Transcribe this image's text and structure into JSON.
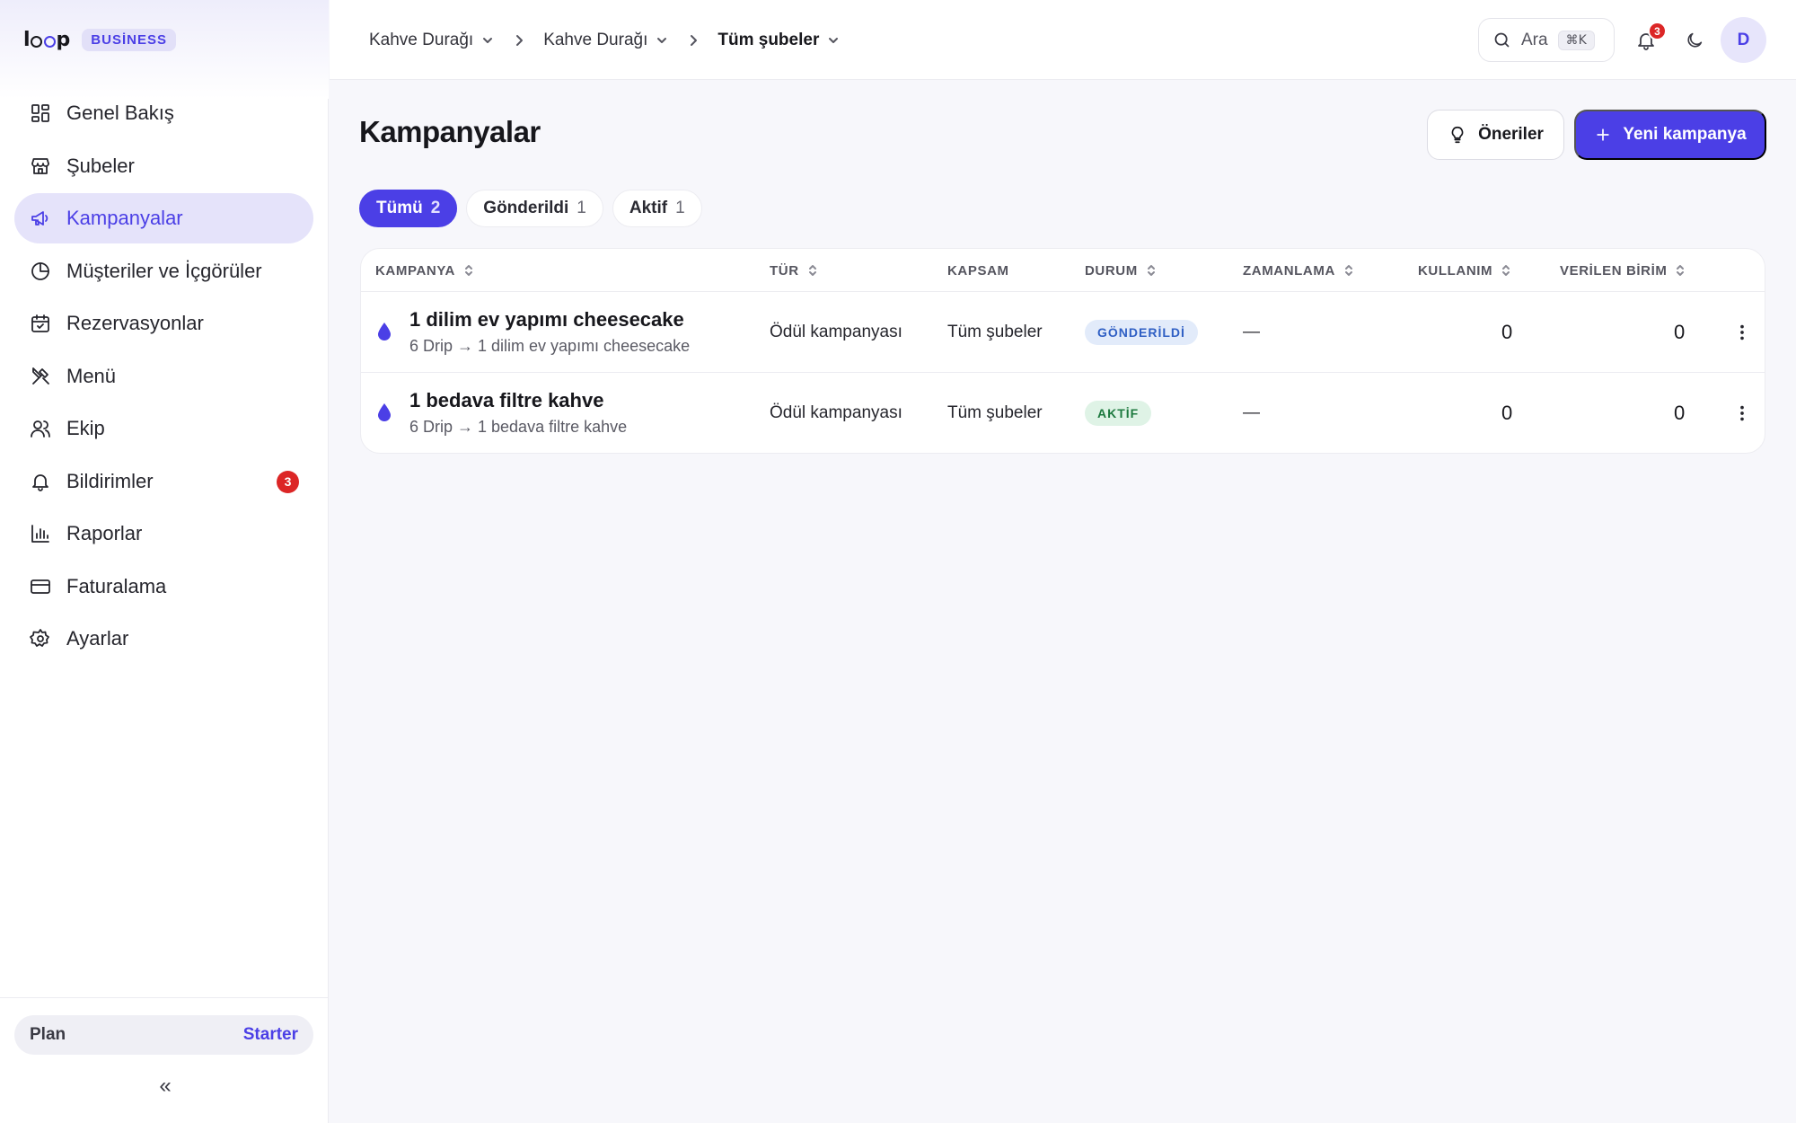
{
  "brand": {
    "logo": "loop",
    "badge": "BUSİNESS"
  },
  "sidebar": {
    "items": [
      {
        "label": "Genel Bakış",
        "icon": "grid-icon"
      },
      {
        "label": "Şubeler",
        "icon": "store-icon"
      },
      {
        "label": "Kampanyalar",
        "icon": "megaphone-icon",
        "active": true
      },
      {
        "label": "Müşteriler ve İçgörüler",
        "icon": "pie-chart-icon"
      },
      {
        "label": "Rezervasyonlar",
        "icon": "calendar-icon"
      },
      {
        "label": "Menü",
        "icon": "utensils-icon"
      },
      {
        "label": "Ekip",
        "icon": "users-icon"
      },
      {
        "label": "Bildirimler",
        "icon": "bell-icon",
        "count": "3"
      },
      {
        "label": "Raporlar",
        "icon": "bar-chart-icon"
      },
      {
        "label": "Faturalama",
        "icon": "credit-card-icon"
      },
      {
        "label": "Ayarlar",
        "icon": "gear-icon"
      }
    ],
    "plan_label": "Plan",
    "plan_value": "Starter",
    "collapse": "«"
  },
  "header": {
    "crumbs": [
      "Kahve Durağı",
      "Kahve Durağı",
      "Tüm şubeler"
    ],
    "search_label": "Ara",
    "search_shortcut": "⌘K",
    "notification_count": "3",
    "avatar_initial": "D"
  },
  "main": {
    "title": "Kampanyalar",
    "suggest_label": "Öneriler",
    "new_label": "Yeni kampanya",
    "filters": [
      {
        "label": "Tümü",
        "count": "2",
        "active": true
      },
      {
        "label": "Gönderildi",
        "count": "1"
      },
      {
        "label": "Aktif",
        "count": "1"
      }
    ],
    "columns": [
      "KAMPANYA",
      "TÜR",
      "KAPSAM",
      "DURUM",
      "ZAMANLAMA",
      "KULLANIM",
      "VERİLEN BİRİM"
    ],
    "rows": [
      {
        "title": "1 dilim ev yapımı cheesecake",
        "subtitle": "6 Drip → 1 dilim ev yapımı cheesecake",
        "type": "Ödül kampanyası",
        "scope": "Tüm şubeler",
        "status": "GÖNDERİLDİ",
        "timing": "—",
        "usage": "0",
        "units": "0"
      },
      {
        "title": "1 bedava filtre kahve",
        "subtitle": "6 Drip → 1 bedava filtre kahve",
        "type": "Ödül kampanyası",
        "scope": "Tüm şubeler",
        "status": "AKTİF",
        "timing": "—",
        "usage": "0",
        "units": "0"
      }
    ]
  },
  "colors": {
    "accent": "#4b3fe6",
    "danger": "#dc2626",
    "sent": "#2f5fc4",
    "active": "#1d7a3f"
  }
}
